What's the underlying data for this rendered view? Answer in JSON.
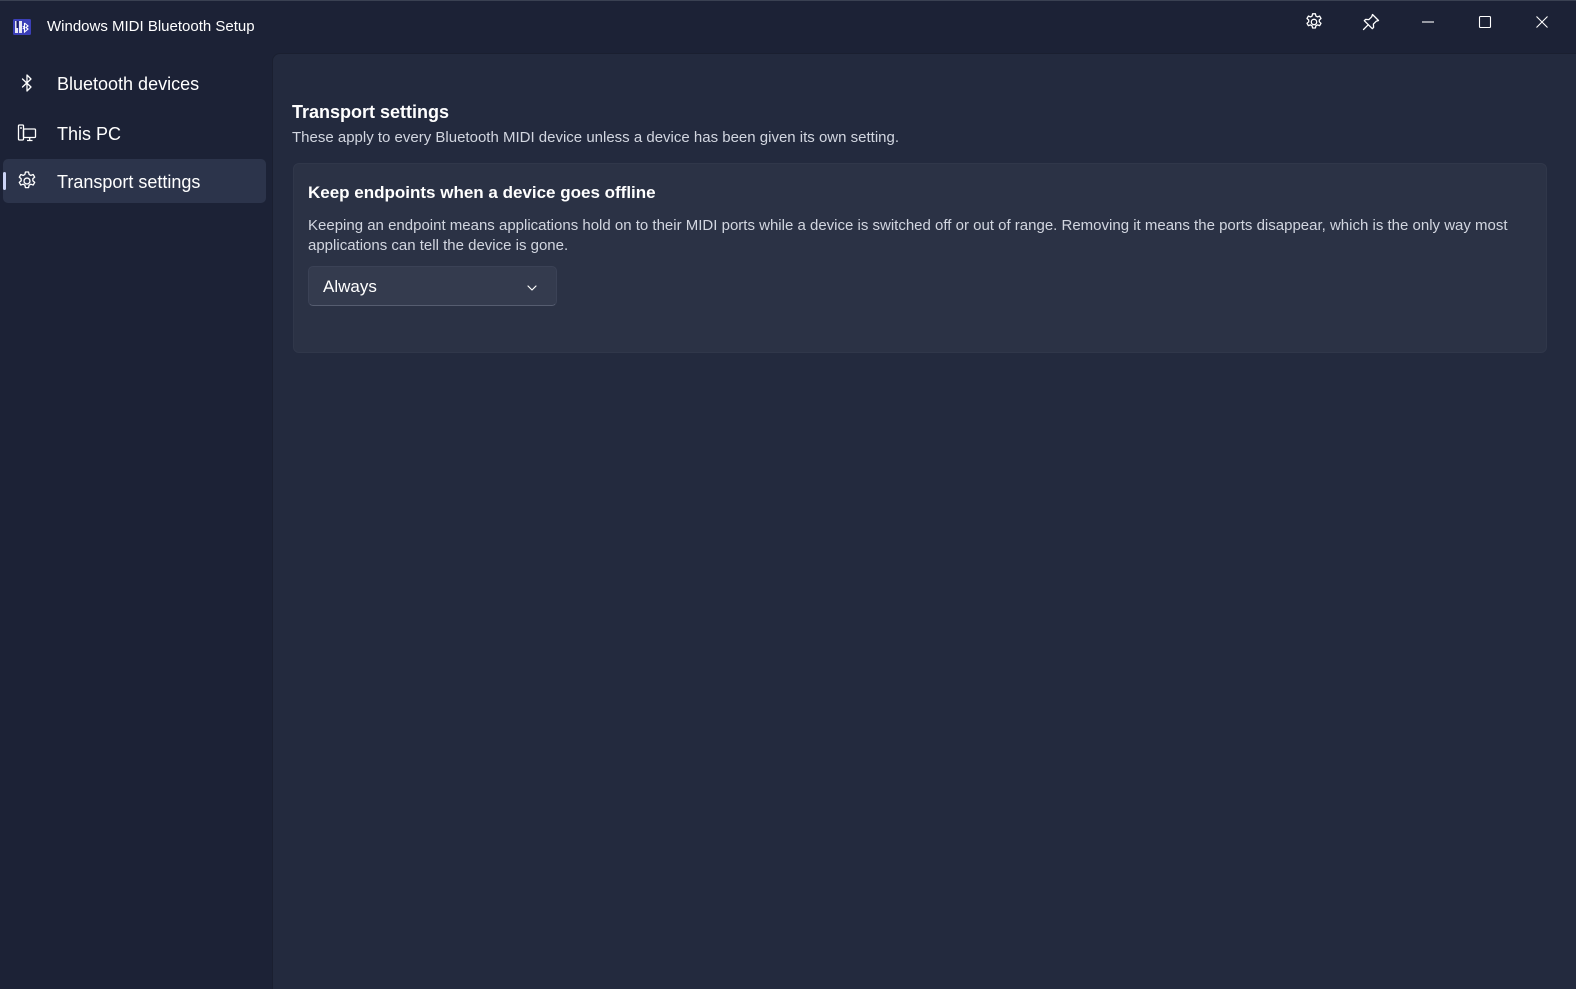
{
  "window": {
    "title": "Windows MIDI Bluetooth Setup",
    "app_icon": "midi-bluetooth-app-icon",
    "controls": [
      "gear-icon",
      "pin-icon",
      "minimize-icon",
      "maximize-icon",
      "close-icon"
    ]
  },
  "sidebar": {
    "items": [
      {
        "label": "Bluetooth devices",
        "icon": "bluetooth-icon",
        "selected": false
      },
      {
        "label": "This PC",
        "icon": "pc-icon",
        "selected": false
      },
      {
        "label": "Transport settings",
        "icon": "gear-icon",
        "selected": true
      }
    ]
  },
  "main": {
    "title": "Transport settings",
    "subtitle": "These apply to every Bluetooth MIDI device unless a device has been given its own setting.",
    "card": {
      "title": "Keep endpoints when a device goes offline",
      "description": "Keeping an endpoint means applications hold on to their MIDI ports while a device is switched off or out of range. Removing it means the ports disappear, which is the only way most applications can tell the device is gone.",
      "dropdown": {
        "selected": "Always"
      }
    }
  },
  "colors": {
    "window_bg": "#1c2236",
    "content_bg": "#232a3e",
    "card_bg": "#2b3245",
    "selected_nav_bg": "#2c344b",
    "accent_indicator": "#cbd3f5"
  }
}
